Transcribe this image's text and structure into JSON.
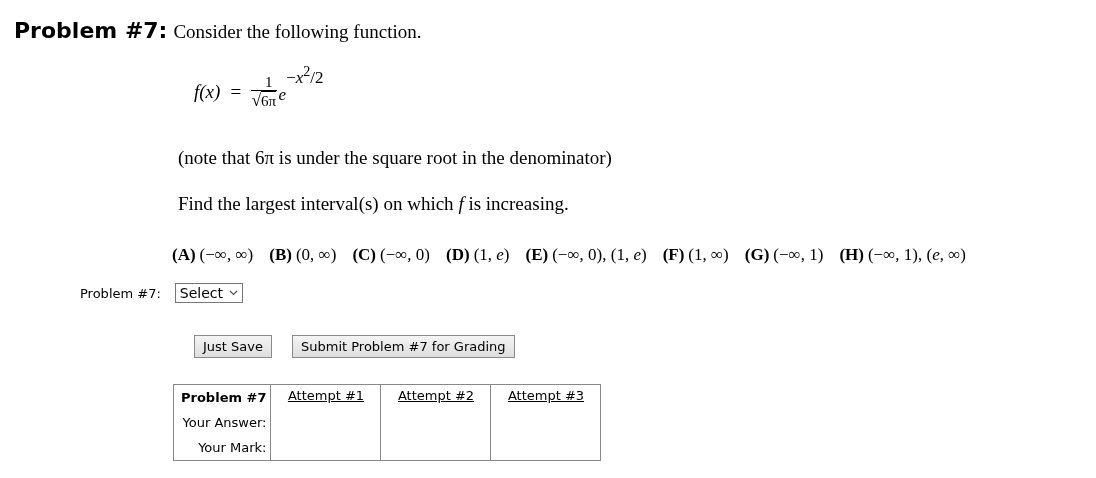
{
  "heading": {
    "label": "Problem #7:",
    "text": "Consider the following function."
  },
  "formula": {
    "lhs": "*f*(*x*)",
    "equals": "=",
    "numerator": "1",
    "radical": "√",
    "radicand": "6π",
    "base": "*e*",
    "exponent": "−*x*$^{2}$/2"
  },
  "note": "(note that 6π is under the square root in the denominator)",
  "question": "Find the largest interval(s) on which *f* is increasing.",
  "choices": [
    {
      "letter": "(A)",
      "text": "(−∞, ∞)"
    },
    {
      "letter": "(B)",
      "text": "(0, ∞)"
    },
    {
      "letter": "(C)",
      "text": "(−∞, 0)"
    },
    {
      "letter": "(D)",
      "text": "(1, *e*)"
    },
    {
      "letter": "(E)",
      "text": "(−∞, 0), (1, *e*)"
    },
    {
      "letter": "(F)",
      "text": "(1, ∞)"
    },
    {
      "letter": "(G)",
      "text": "(−∞, 1)"
    },
    {
      "letter": "(H)",
      "text": "(−∞, 1), (*e*, ∞)"
    }
  ],
  "answer": {
    "label": "Problem #7:",
    "value": "Select"
  },
  "buttons": [
    "Just Save",
    "Submit Problem #7 for Grading"
  ],
  "attempts_table": {
    "header": "Problem #7",
    "row_labels": [
      "Your Answer:",
      "Your Mark:"
    ],
    "columns": [
      "Attempt #1",
      "Attempt #2",
      "Attempt #3"
    ]
  }
}
